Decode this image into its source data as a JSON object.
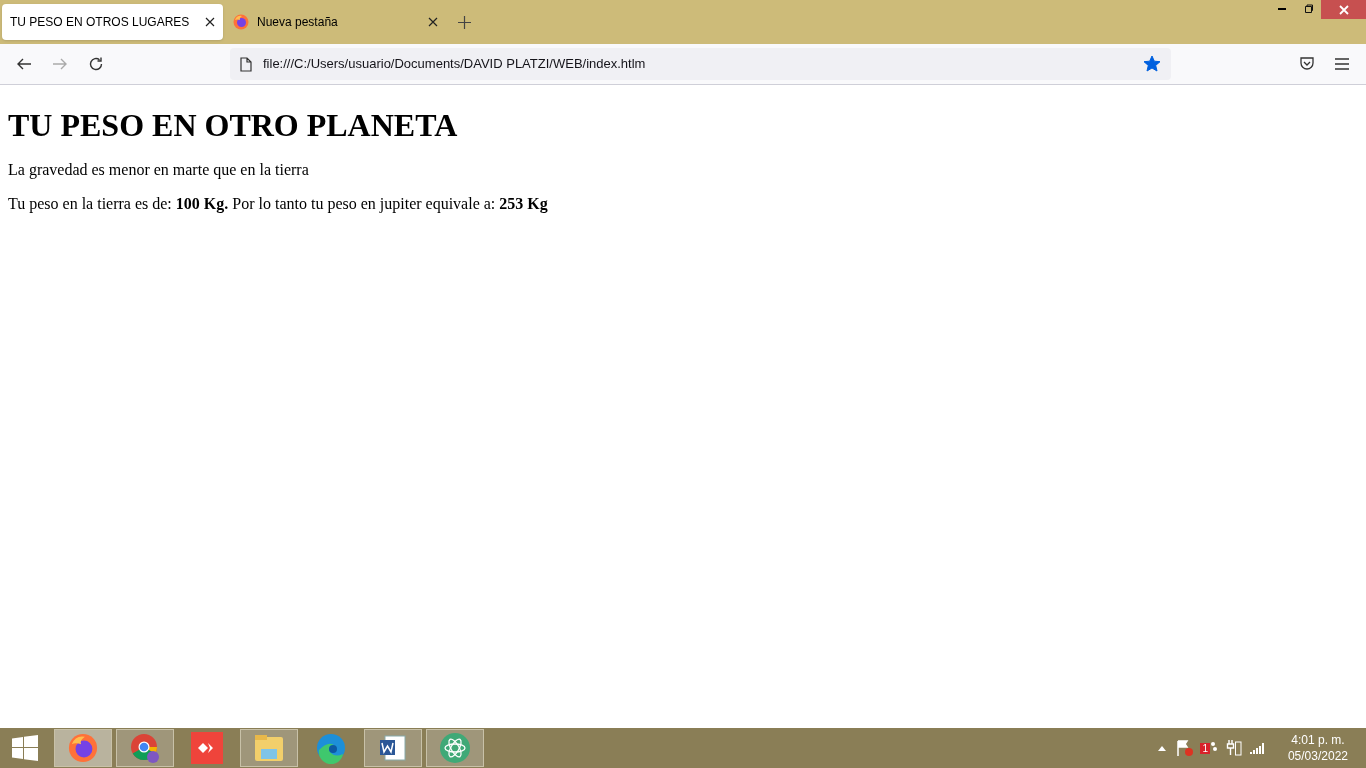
{
  "tabs": [
    {
      "title": "TU PESO EN OTROS LUGARES",
      "selected": true,
      "favicon": false
    },
    {
      "title": "Nueva pestaña",
      "selected": false,
      "favicon": true
    }
  ],
  "address_bar": {
    "url": "file:///C:/Users/usuario/Documents/DAVID PLATZI/WEB/index.htlm",
    "bookmarked": true
  },
  "page": {
    "heading": "TU PESO EN OTRO PLANETA",
    "paragraphs": [
      "La gravedad es menor en marte que en la tierra",
      "Tu peso en la tierra es de: **100 Kg.** Por lo tanto tu peso en jupiter equivale a: **253 Kg**"
    ]
  },
  "taskbar": {
    "apps": [
      {
        "kind": "firefox",
        "running": true,
        "selected": true
      },
      {
        "kind": "chrome",
        "running": true,
        "selected": false
      },
      {
        "kind": "anydesk",
        "running": false,
        "selected": false
      },
      {
        "kind": "explorer",
        "running": true,
        "selected": false
      },
      {
        "kind": "edge",
        "running": false,
        "selected": false
      },
      {
        "kind": "word",
        "running": true,
        "selected": false
      },
      {
        "kind": "atom",
        "running": true,
        "selected": false
      }
    ],
    "notification_badge": "1",
    "time": "4:01 p. m.",
    "date": "05/03/2022"
  }
}
